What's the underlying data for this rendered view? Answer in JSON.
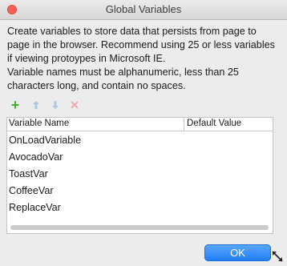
{
  "window": {
    "title": "Global Variables"
  },
  "description": "Create variables to store data that persists from page to page in the browser. Recommend using 25 or less variables if viewing protoypes in Microsoft IE.",
  "rules": "Variable names must be alphanumeric, less than 25 characters long, and contain no spaces.",
  "toolbar": {
    "add_icon": "plus-icon",
    "up_icon": "arrow-up-icon",
    "down_icon": "arrow-down-icon",
    "delete_icon": "x-icon"
  },
  "table": {
    "columns": [
      "Variable Name",
      "Default Value"
    ],
    "rows": [
      {
        "name": "OnLoadVariable",
        "value": ""
      },
      {
        "name": "AvocadoVar",
        "value": ""
      },
      {
        "name": "ToastVar",
        "value": ""
      },
      {
        "name": "CoffeeVar",
        "value": ""
      },
      {
        "name": "ReplaceVar",
        "value": ""
      }
    ]
  },
  "buttons": {
    "ok": "OK"
  },
  "colors": {
    "accent": "#1f7cf5",
    "add": "#3fae2a",
    "delete": "#f1a7a7",
    "arrows": "#a9c8e6"
  }
}
